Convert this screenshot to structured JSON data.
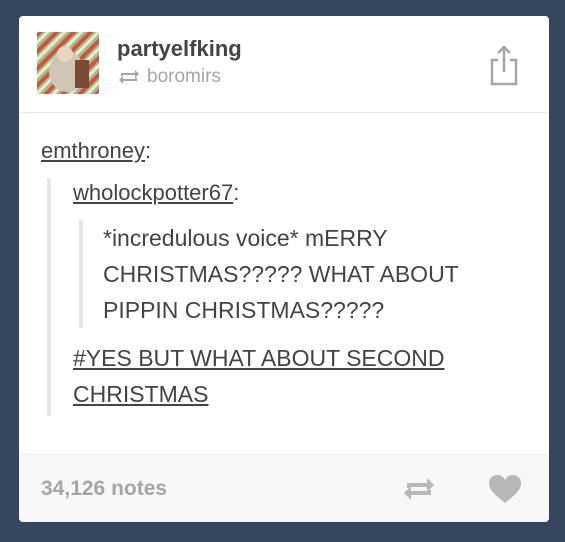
{
  "post": {
    "author": "partyelfking",
    "reblogged_from": "boromirs"
  },
  "content": {
    "source_user": "emthroney",
    "inner_user": "wholockpotter67",
    "colon": ":",
    "quote_text": "*incredulous voice* mERRY CHRISTMAS????? WHAT ABOUT PIPPIN CHRISTMAS?????",
    "reply_text": "#YES BUT WHAT ABOUT SECOND CHRISTMAS"
  },
  "footer": {
    "notes": "34,126 notes"
  },
  "colors": {
    "background": "#36465d",
    "text": "#444444",
    "muted": "#a6a6a6"
  }
}
